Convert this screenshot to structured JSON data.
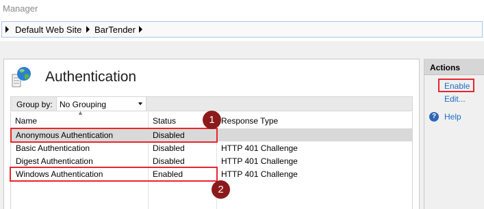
{
  "window": {
    "title": "Manager"
  },
  "breadcrumb": {
    "items": [
      "Default Web Site",
      "BarTender"
    ]
  },
  "feature": {
    "title": "Authentication"
  },
  "groupby": {
    "label": "Group by:",
    "value": "No Grouping"
  },
  "table": {
    "columns": [
      "Name",
      "Status",
      "Response Type"
    ],
    "rows": [
      {
        "name": "Anonymous Authentication",
        "status": "Disabled",
        "response": ""
      },
      {
        "name": "Basic Authentication",
        "status": "Disabled",
        "response": "HTTP 401 Challenge"
      },
      {
        "name": "Digest Authentication",
        "status": "Disabled",
        "response": "HTTP 401 Challenge"
      },
      {
        "name": "Windows Authentication",
        "status": "Enabled",
        "response": "HTTP 401 Challenge"
      }
    ]
  },
  "annotations": {
    "badge1": "1",
    "badge2": "2",
    "highlight_color": "#e8242b",
    "badge_color": "#8b1a1a"
  },
  "actions": {
    "header": "Actions",
    "enable": "Enable",
    "edit": "Edit...",
    "help": "Help"
  },
  "icons": {
    "globe": "globe-icon",
    "help": "help-icon",
    "breadcrumb": "chevron-right-icon"
  }
}
